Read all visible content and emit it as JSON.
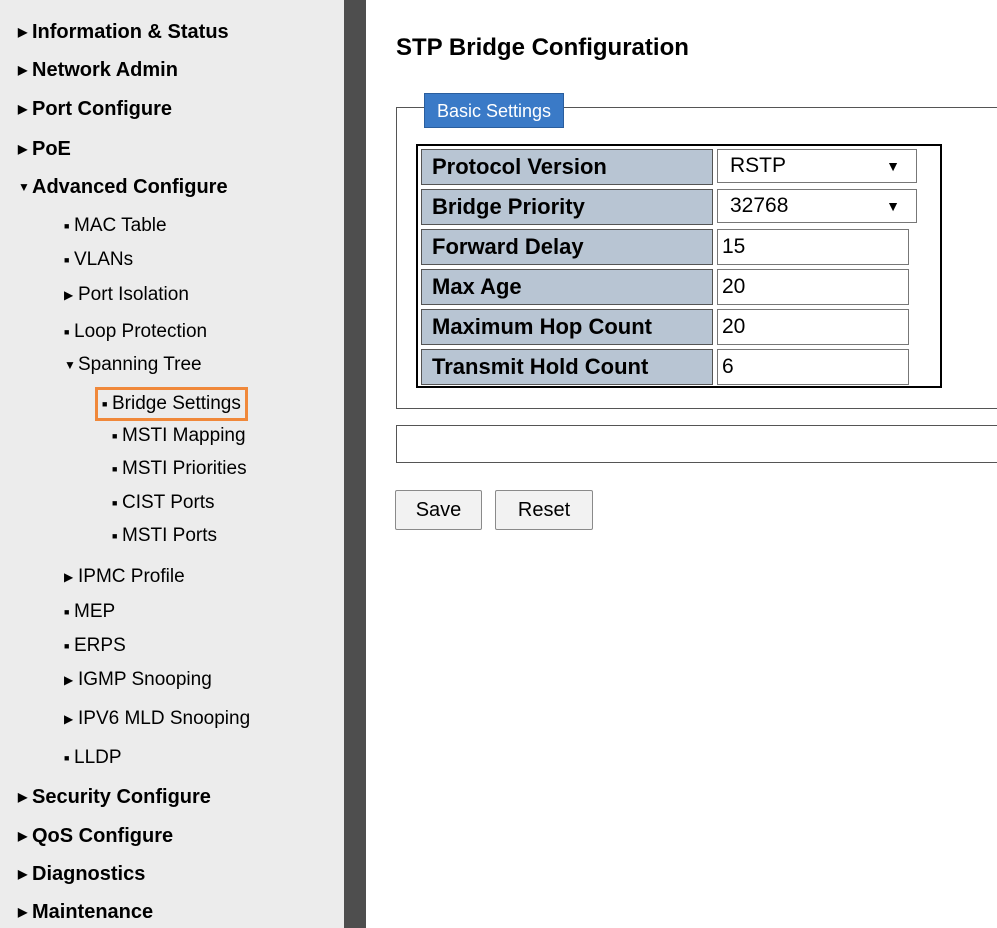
{
  "sidebar": {
    "items": [
      {
        "label": "Information & Status",
        "glyph": "▶"
      },
      {
        "label": "Network Admin",
        "glyph": "▶"
      },
      {
        "label": "Port Configure",
        "glyph": "▶"
      },
      {
        "label": "PoE",
        "glyph": "▶"
      },
      {
        "label": "Advanced Configure",
        "glyph": "▼"
      },
      {
        "label": "MAC Table",
        "glyph": "■"
      },
      {
        "label": "VLANs",
        "glyph": "■"
      },
      {
        "label": "Port Isolation",
        "glyph": "▶"
      },
      {
        "label": "Loop Protection",
        "glyph": "■"
      },
      {
        "label": "Spanning Tree",
        "glyph": "▼"
      },
      {
        "label": "Bridge Settings",
        "glyph": "■"
      },
      {
        "label": "MSTI Mapping",
        "glyph": "■"
      },
      {
        "label": "MSTI Priorities",
        "glyph": "■"
      },
      {
        "label": "CIST Ports",
        "glyph": "■"
      },
      {
        "label": "MSTI Ports",
        "glyph": "■"
      },
      {
        "label": "IPMC Profile",
        "glyph": "▶"
      },
      {
        "label": "MEP",
        "glyph": "■"
      },
      {
        "label": "ERPS",
        "glyph": "■"
      },
      {
        "label": "IGMP Snooping",
        "glyph": "▶"
      },
      {
        "label": "IPV6 MLD Snooping",
        "glyph": "▶"
      },
      {
        "label": "LLDP",
        "glyph": "■"
      },
      {
        "label": "Security Configure",
        "glyph": "▶"
      },
      {
        "label": "QoS Configure",
        "glyph": "▶"
      },
      {
        "label": "Diagnostics",
        "glyph": "▶"
      },
      {
        "label": "Maintenance",
        "glyph": "▶"
      }
    ]
  },
  "main": {
    "title": "STP Bridge Configuration",
    "legend": "Basic Settings",
    "rows": [
      {
        "label": "Protocol Version",
        "value": "RSTP",
        "arrow": "▼"
      },
      {
        "label": "Bridge Priority",
        "value": "32768",
        "arrow": "▼"
      },
      {
        "label": "Forward Delay",
        "value": "15"
      },
      {
        "label": "Max Age",
        "value": "20"
      },
      {
        "label": "Maximum Hop Count",
        "value": "20"
      },
      {
        "label": "Transmit Hold Count",
        "value": "6"
      }
    ],
    "save_label": "Save",
    "reset_label": "Reset"
  },
  "colors": {
    "sidebar_bg": "#ececec",
    "divider": "#4e4e4e",
    "legend_bg": "#3a7ac7",
    "label_cell_bg": "#b8c5d3",
    "selected_outline": "#f0883a"
  }
}
